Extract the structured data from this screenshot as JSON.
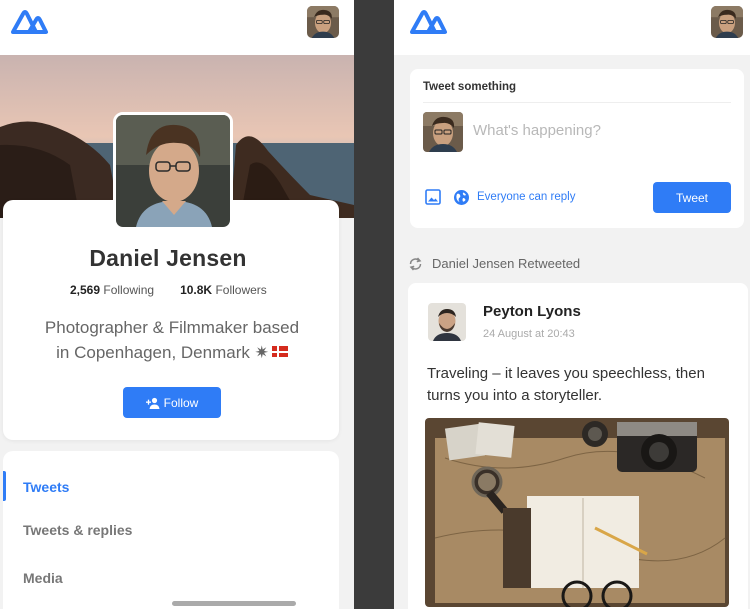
{
  "profile_screen": {
    "name": "Daniel Jensen",
    "following_count": "2,569",
    "following_label": "Following",
    "followers_count": "10.8K",
    "followers_label": "Followers",
    "bio_line1": "Photographer & Filmmaker based",
    "bio_line2": "in Copenhagen, Denmark ✷",
    "follow_label": "Follow",
    "tabs": [
      {
        "label": "Tweets",
        "active": true
      },
      {
        "label": "Tweets & replies",
        "active": false
      },
      {
        "label": "Media",
        "active": false
      }
    ]
  },
  "feed_screen": {
    "compose": {
      "title": "Tweet something",
      "placeholder": "What's happening?",
      "reply_setting": "Everyone can reply",
      "tweet_label": "Tweet"
    },
    "retweet_notice": "Daniel Jensen Retweeted",
    "post": {
      "author": "Peyton Lyons",
      "time": "24 August at 20:43",
      "text": "Traveling – it leaves you speechless, then turns you into a storyteller."
    }
  },
  "colors": {
    "accent": "#2f7cf6",
    "background": "#f2f2f2",
    "card": "#ffffff"
  },
  "icons": [
    "app-logo-icon",
    "image-icon",
    "globe-icon",
    "retweet-icon",
    "add-person-icon"
  ]
}
